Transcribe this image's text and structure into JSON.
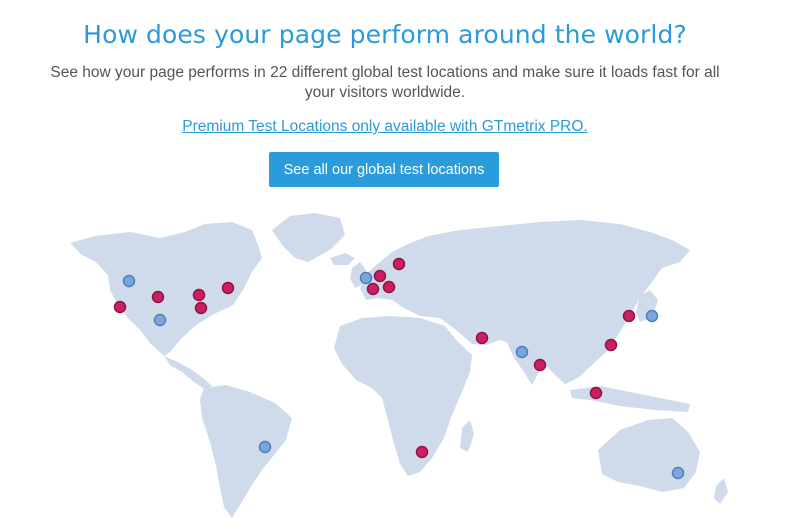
{
  "header": {
    "title": "How does your page perform around the world?",
    "subtitle": "See how your page performs in 22 different global test locations and make sure it loads fast for all your visitors worldwide.",
    "premium_link_text": "Premium Test Locations only available with GTmetrix PRO.",
    "cta_label": "See all our global test locations"
  },
  "map": {
    "colors": {
      "land": "#cfdbea",
      "premium_marker": "#cc1f62",
      "standard_marker": "#7aa6db"
    },
    "markers": [
      {
        "type": "standard"
      },
      {
        "type": "premium"
      },
      {
        "type": "premium"
      },
      {
        "type": "premium"
      },
      {
        "type": "premium"
      },
      {
        "type": "standard"
      },
      {
        "type": "premium"
      },
      {
        "type": "standard"
      },
      {
        "type": "premium"
      },
      {
        "type": "premium"
      },
      {
        "type": "premium"
      },
      {
        "type": "premium"
      },
      {
        "type": "standard"
      },
      {
        "type": "premium"
      },
      {
        "type": "premium"
      },
      {
        "type": "premium"
      },
      {
        "type": "premium"
      },
      {
        "type": "standard"
      },
      {
        "type": "premium"
      },
      {
        "type": "premium"
      },
      {
        "type": "standard"
      },
      {
        "type": "standard"
      }
    ]
  }
}
